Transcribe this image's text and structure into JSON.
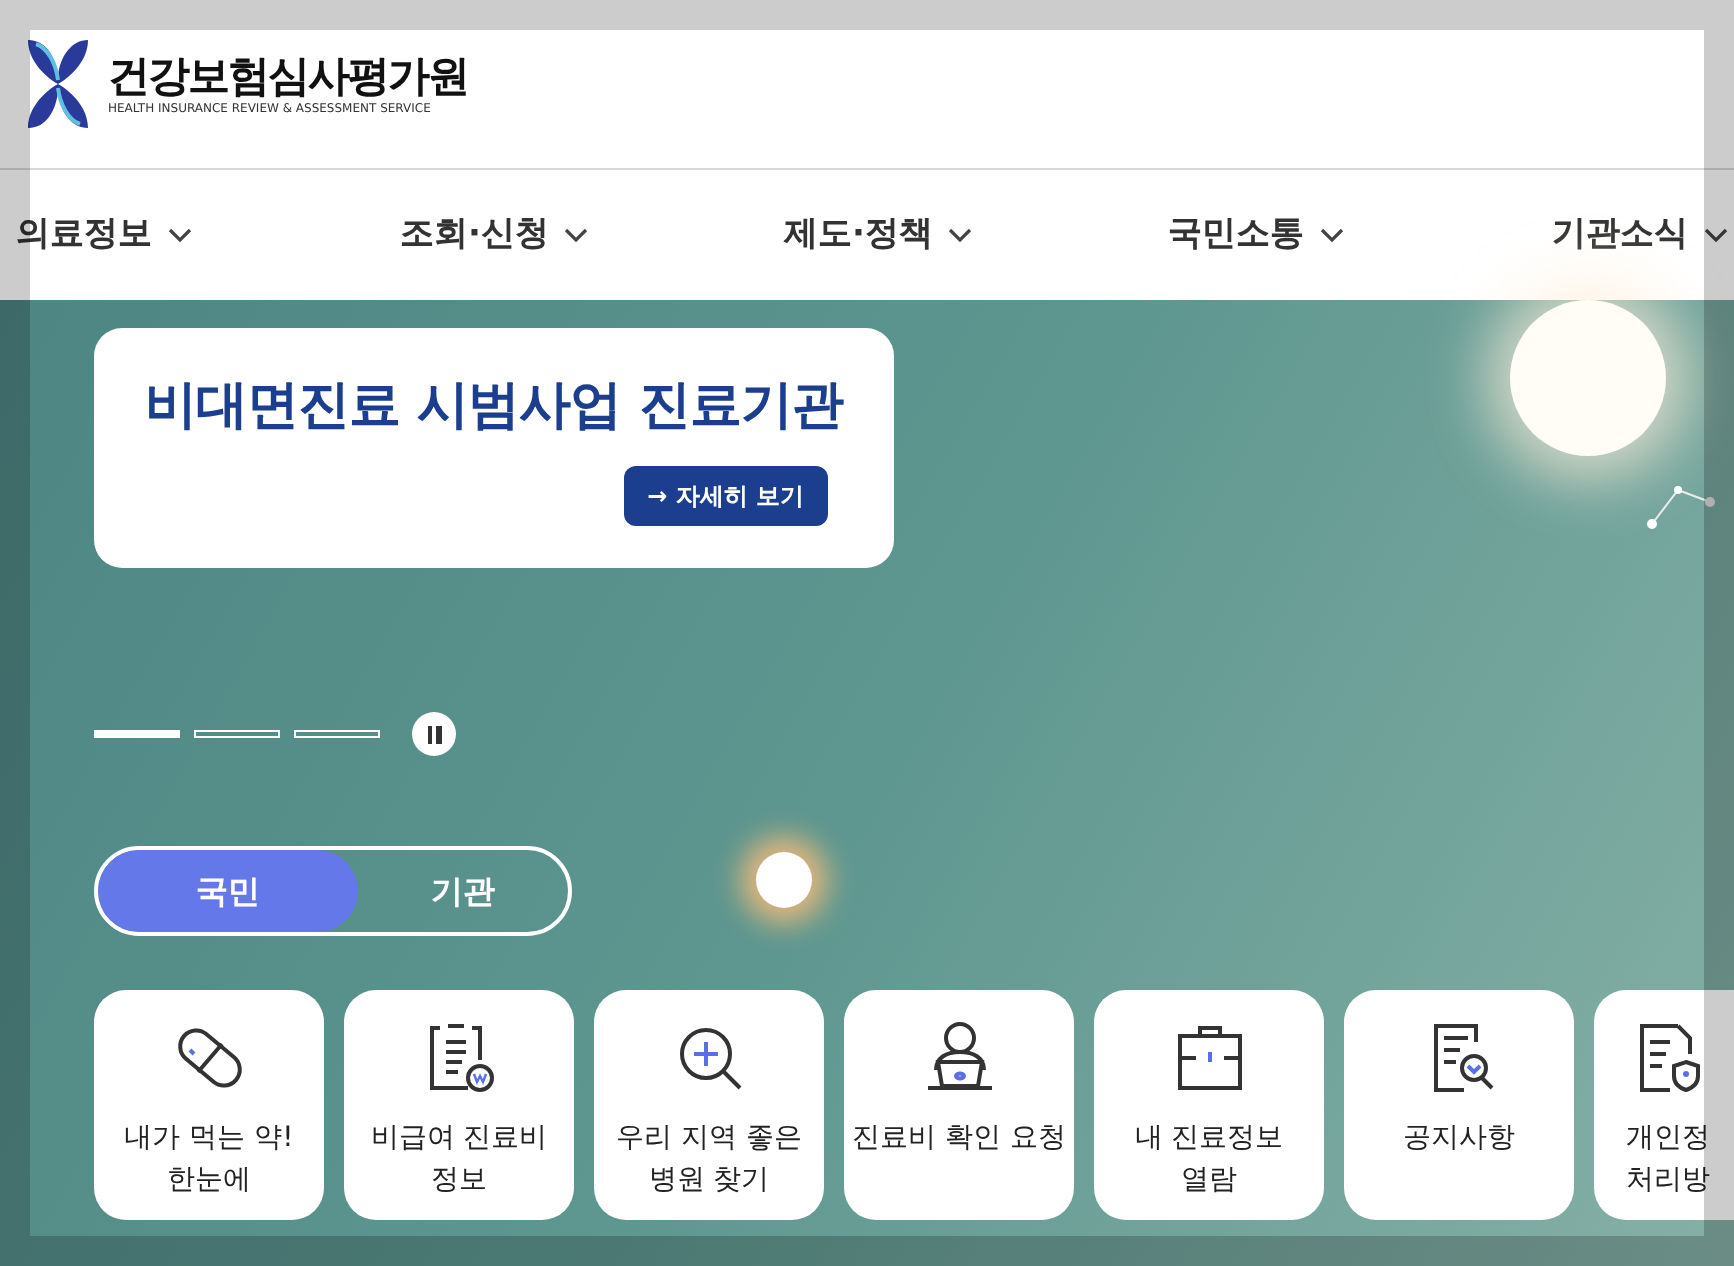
{
  "logo": {
    "name": "건강보험심사평가원",
    "subtitle": "HEALTH INSURANCE REVIEW & ASSESSMENT SERVICE"
  },
  "nav": [
    {
      "label": "의료정보"
    },
    {
      "label": "조회·신청"
    },
    {
      "label": "제도·정책"
    },
    {
      "label": "국민소통"
    },
    {
      "label": "기관소식"
    }
  ],
  "banner": {
    "title": "비대면진료 시범사업 진료기관",
    "button": "→ 자세히 보기"
  },
  "slides": [
    {
      "selected": true
    },
    {
      "selected": false
    },
    {
      "selected": false
    }
  ],
  "audience_tabs": [
    {
      "label": "국민",
      "selected": true
    },
    {
      "label": "기관",
      "selected": false
    }
  ],
  "services": [
    {
      "kind": "pill",
      "lines": [
        "내가 먹는 약!",
        "한눈에"
      ]
    },
    {
      "kind": "bill",
      "lines": [
        "비급여 진료비",
        "정보"
      ]
    },
    {
      "kind": "search",
      "lines": [
        "우리 지역 좋은",
        "병원 찾기"
      ]
    },
    {
      "kind": "person",
      "lines": [
        "진료비 확인 요청"
      ]
    },
    {
      "kind": "briefcase",
      "lines": [
        "내 진료정보",
        "열람"
      ]
    },
    {
      "kind": "notice",
      "lines": [
        "공지사항"
      ]
    },
    {
      "kind": "shield",
      "lines": [
        "개인정",
        "처리방"
      ],
      "cut": true
    }
  ]
}
